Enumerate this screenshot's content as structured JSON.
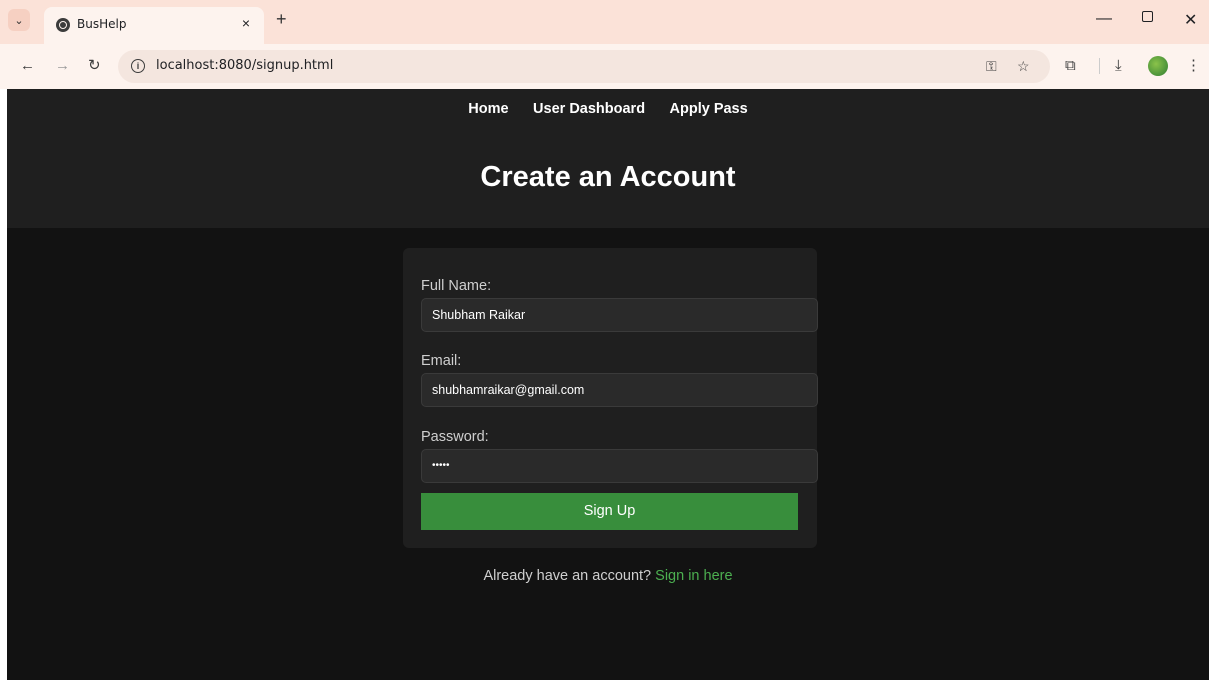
{
  "browser": {
    "tab_title": "BusHelp",
    "url": "localhost:8080/signup.html",
    "new_tab_glyph": "+",
    "close_glyph": "×"
  },
  "nav": {
    "items": [
      {
        "label": "Home"
      },
      {
        "label": "User Dashboard"
      },
      {
        "label": "Apply Pass"
      }
    ]
  },
  "page_title": "Create an Account",
  "form": {
    "full_name_label": "Full Name:",
    "full_name_value": "Shubham Raikar",
    "email_label": "Email:",
    "email_value": "shubhamraikar@gmail.com",
    "password_label": "Password:",
    "password_value": "•••••",
    "submit_label": "Sign Up"
  },
  "footer": {
    "prompt": "Already have an account? ",
    "link_text": "Sign in here"
  },
  "colors": {
    "page_bg": "#121212",
    "header_bg": "#1f1f1f",
    "card_bg": "#1f1f1f",
    "accent_green": "#388e3c",
    "link_green": "#4caf50"
  }
}
